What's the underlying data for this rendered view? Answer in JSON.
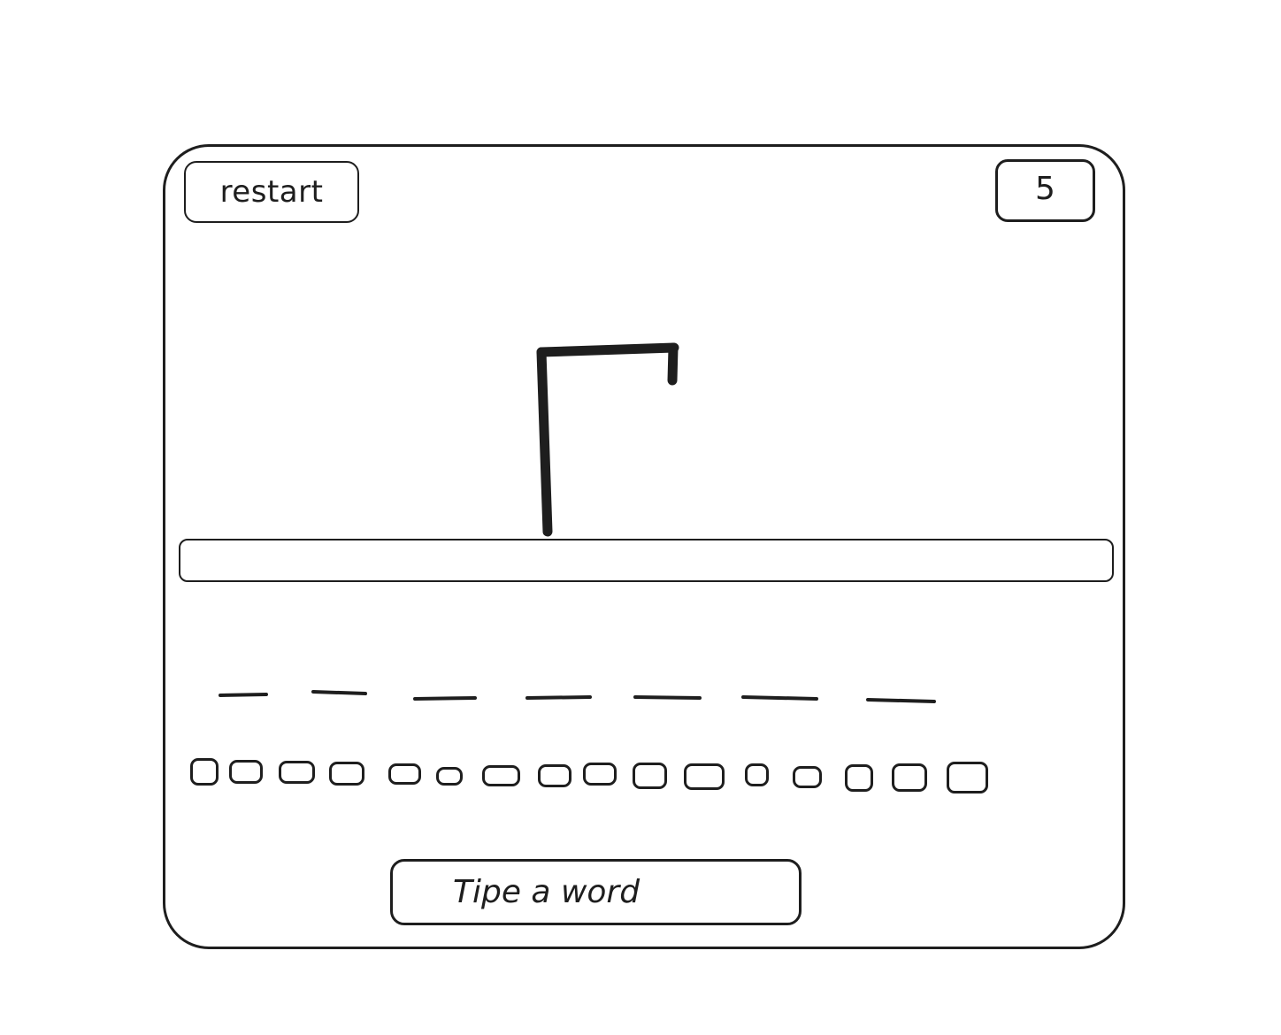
{
  "header": {
    "restart_label": "restart",
    "counter_value": "5"
  },
  "word": {
    "letter_count": 7
  },
  "keyboard": {
    "key_count": 16
  },
  "input": {
    "placeholder": "Tipe a word"
  },
  "colors": {
    "ink": "#1e1e1e",
    "background": "#ffffff"
  }
}
